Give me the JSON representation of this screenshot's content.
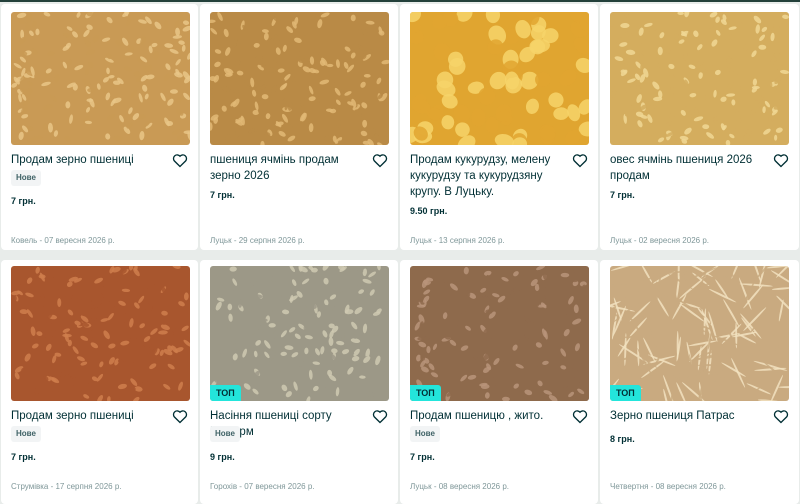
{
  "listings": [
    {
      "title": "Продам зерно пшениці",
      "badge": "Нове",
      "price": "7 грн.",
      "meta": "Ковель - 07 вересня 2026 р.",
      "image": "wheat-grain-photo",
      "top": "",
      "bg": "#c99a55",
      "fg": "#e9c587"
    },
    {
      "title": "пшениця ячмінь продам зерно 2026",
      "badge": "",
      "price": "7 грн.",
      "meta": "Луцьк - 29 серпня 2026 р.",
      "image": "grain-sack-photo",
      "top": "",
      "bg": "#b98a46",
      "fg": "#e2b875"
    },
    {
      "title": "Продам кукурудзу, мелену кукурудзу та кукурудзяну крупу. В Луцьку.",
      "badge": "",
      "price": "9.50 грн.",
      "meta": "Луцьк - 13 серпня 2026 р.",
      "image": "corn-kernels-photo",
      "top": "",
      "bg": "#e0a530",
      "fg": "#f6d46a"
    },
    {
      "title": "овес ячмінь пшениця 2026 продам",
      "badge": "",
      "price": "7 грн.",
      "meta": "Луцьк - 02 вересня 2026 р.",
      "image": "oat-grain-photo",
      "top": "",
      "bg": "#d4ad5e",
      "fg": "#f0d794"
    },
    {
      "title": "Продам зерно пшениці",
      "badge": "Нове",
      "price": "7 грн.",
      "meta": "Струмівка - 17 серпня 2026 р.",
      "image": "red-wheat-photo",
      "top": "",
      "bg": "#a8562e",
      "fg": "#cf7e4c"
    },
    {
      "title": "Насіння пшениці сорту Реформ",
      "badge": "Нове",
      "price": "9 грн.",
      "meta": "Горохів - 07 вересня 2026 р.",
      "image": "seed-wheat-photo",
      "top": "ТОП",
      "bg": "#9c9887",
      "fg": "#cfc9b2"
    },
    {
      "title": "Продам пшеницю , жито.",
      "badge": "Нове",
      "price": "7 грн.",
      "meta": "Луцьк - 08 вересня 2026 р.",
      "image": "rye-grain-photo",
      "top": "ТОП",
      "bg": "#8e6a4c",
      "fg": "#b8947a"
    },
    {
      "title": "Зерно пшениця Патрас",
      "badge": "",
      "price": "8 грн.",
      "meta": "Четвертня - 08 вересня 2026 р.",
      "image": "wheat-field-photo",
      "top": "ТОП",
      "bg": "#c9aa80",
      "fg": "#f2e2c0"
    }
  ]
}
